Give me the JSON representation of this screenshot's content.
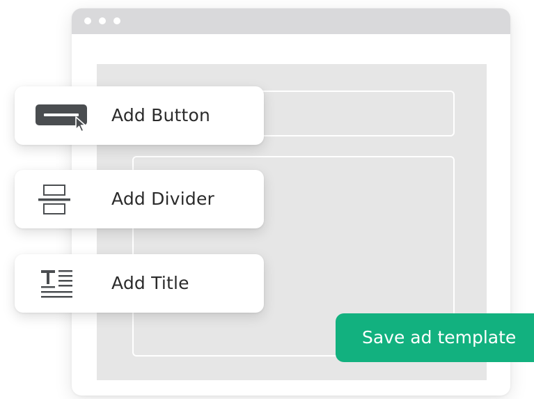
{
  "colors": {
    "accent": "#12b17f",
    "browser_bar": "#d9d9db",
    "canvas": "#e6e6e6",
    "icon_dark": "#4a4d50"
  },
  "actions": [
    {
      "label": "Add Button",
      "icon": "button-icon"
    },
    {
      "label": "Add Divider",
      "icon": "divider-icon"
    },
    {
      "label": "Add Title",
      "icon": "title-icon"
    }
  ],
  "save_button": {
    "label": "Save ad template"
  }
}
